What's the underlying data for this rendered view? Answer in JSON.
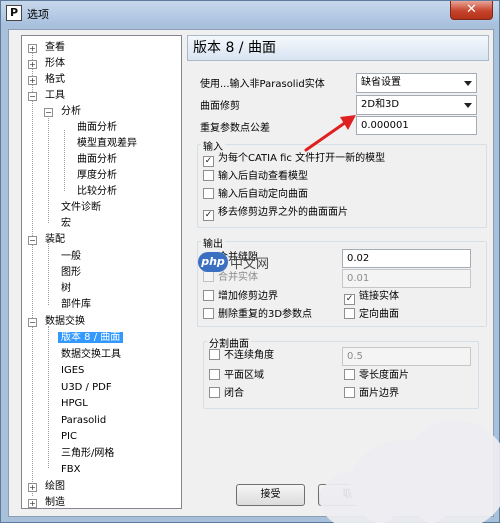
{
  "window": {
    "title": "选项",
    "app_icon_letter": "P",
    "close_symbol": "✕"
  },
  "tree": {
    "expand_symbol": "+",
    "collapse_symbol": "−",
    "items": [
      "查看",
      "形体",
      "格式",
      "工具",
      "分析",
      "曲面分析",
      "模型直观差异",
      "曲面分析",
      "厚度分析",
      "比较分析",
      "文件诊断",
      "宏",
      "装配",
      "一般",
      "图形",
      "树",
      "部件库",
      "数据交换",
      "版本 8 / 曲面",
      "数据交换工具",
      "IGES",
      "U3D / PDF",
      "HPGL",
      "Parasolid",
      "PIC",
      "三角形/网格",
      "FBX",
      "绘图",
      "制造"
    ]
  },
  "panel": {
    "header": "版本 8 / 曲面",
    "import_label": "使用...输入非Parasolid实体",
    "import_value": "缺省设置",
    "trim_label": "曲面修剪",
    "trim_value": "2D和3D",
    "tolerance_label": "重复参数点公差",
    "tolerance_value": "0.000001",
    "input_group": {
      "title": "输入",
      "options": [
        {
          "label": "为每个CATIA fic 文件打开一新的模型",
          "checked": true
        },
        {
          "label": "输入后自动查看模型",
          "checked": false
        },
        {
          "label": "输入后自动定向曲面",
          "checked": false
        },
        {
          "label": "移去修剪边界之外的曲面面片",
          "checked": true
        }
      ]
    },
    "output_group": {
      "title": "输出",
      "merge_label": "合并缝隙",
      "merge_value": "0.02",
      "merge_checked": true,
      "solid_label": "合并实体",
      "solid_value": "0.01",
      "solid_checked": false,
      "add_trim": "增加修剪边界",
      "link_solid": "链接实体",
      "delete_3d": "删除重复的3D参数点",
      "orient_surface": "定向曲面",
      "check_mark": "✓"
    },
    "split_group": {
      "title": "分割曲面",
      "discontinuous_angle": "不连续角度",
      "angle_value": "0.5",
      "planar_region": "平面区域",
      "zero_length": "零长度面片",
      "closed": "闭合",
      "patch_boundary": "面片边界"
    },
    "buttons": {
      "ok": "接受",
      "cancel": "取消"
    }
  },
  "watermark": {
    "badge": "php",
    "text": "中文网"
  },
  "colors": {
    "selection": "#3399ff",
    "annotation_arrow": "#e02020",
    "title_bar": "#a9c1de",
    "close_button": "#c7432c"
  }
}
